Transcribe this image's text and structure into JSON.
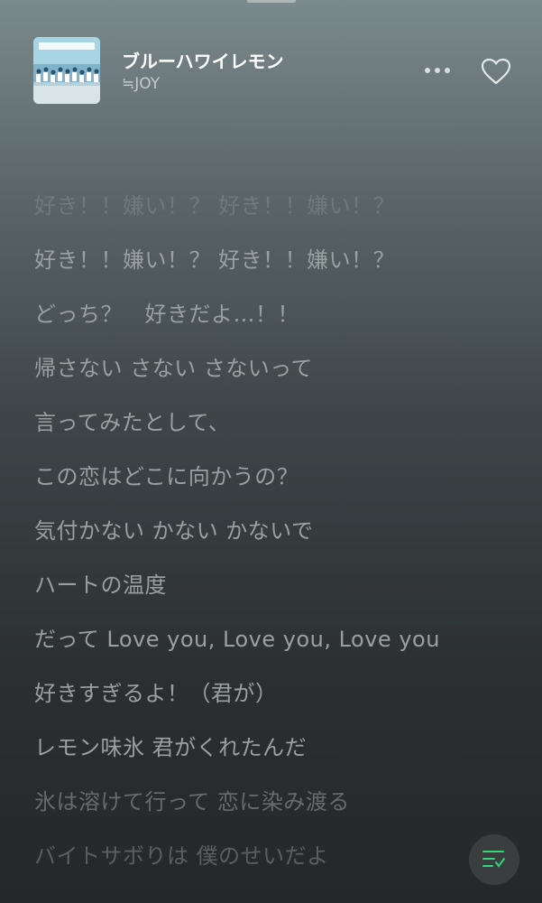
{
  "player": {
    "song_title": "ブルーハワイレモン",
    "artist": "≒JOY",
    "icons": {
      "more": "more-dots-icon",
      "like": "heart-outline-icon",
      "queue": "queue-list-icon"
    },
    "accent_color": "#2fd67a"
  },
  "lyrics": [
    "好き！！嫌い！？ 好き！！嫌い！？",
    "好き！！嫌い！？ 好き！！嫌い！？",
    "どっち？　好きだよ…！！",
    "帰さない さない さないって",
    "言ってみたとして、",
    "この恋はどこに向かうの？",
    "気付かない かない かないで",
    "ハートの温度",
    "だって Love you, Love you, Love you",
    "好きすぎるよ！（君が）",
    "レモン味氷 君がくれたんだ",
    "氷は溶けて行って 恋に染み渡る",
    "バイトサボりは 僕のせいだよ"
  ]
}
